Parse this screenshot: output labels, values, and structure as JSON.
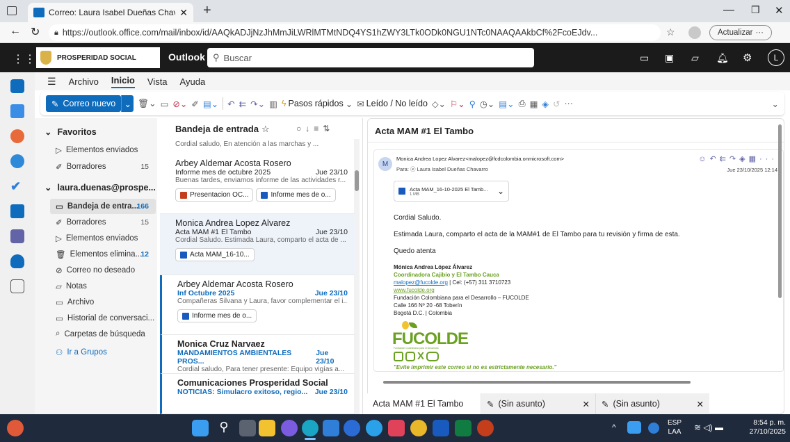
{
  "browser": {
    "tab_title": "Correo: Laura Isabel Dueñas Chav",
    "url": "https://outlook.office.com/mail/inbox/id/AAQkADJjNzJhMmJiLWRlMTMtNDQ4YS1hZWY3LTk0ODk0NGU1NTc0NAAQAAkbCf%2FcoEJdv...",
    "update_label": "Actualizar"
  },
  "header": {
    "brand": "PROSPERIDAD SOCIAL",
    "app": "Outlook",
    "search_placeholder": "Buscar",
    "avatar": "L"
  },
  "ribbon_tabs": [
    "Archivo",
    "Inicio",
    "Vista",
    "Ayuda"
  ],
  "ribbon": {
    "new_mail": "Correo nuevo",
    "quick_steps": "Pasos rápidos",
    "read_unread": "Leído / No leído"
  },
  "folders": {
    "favorites_label": "Favoritos",
    "favorites": [
      {
        "label": "Elementos enviados",
        "count": ""
      },
      {
        "label": "Borradores",
        "count": "15"
      }
    ],
    "account_label": "laura.duenas@prospe...",
    "account_items": [
      {
        "label": "Bandeja de entra...",
        "count": "166"
      },
      {
        "label": "Borradores",
        "count": "15"
      },
      {
        "label": "Elementos enviados",
        "count": ""
      },
      {
        "label": "Elementos elimina...",
        "count": "12"
      },
      {
        "label": "Correo no deseado",
        "count": ""
      },
      {
        "label": "Notas",
        "count": ""
      },
      {
        "label": "Archivo",
        "count": ""
      },
      {
        "label": "Historial de conversaci...",
        "count": ""
      },
      {
        "label": "Carpetas de búsqueda",
        "count": ""
      }
    ],
    "groups_link": "Ir a Grupos"
  },
  "list": {
    "title": "Bandeja de entrada",
    "top_preview": "Cordial saludo, En atención a las marchas y ...",
    "messages": [
      {
        "from": "Arbey Aldemar Acosta Rosero",
        "subject": "Informe mes de octubre 2025",
        "date": "Jue 23/10",
        "preview": "Buenas tardes, enviamos informe de las actividades r...",
        "attachments": [
          "Presentacion OC...",
          "Informe mes de o..."
        ]
      },
      {
        "from": "Monica Andrea Lopez Alvarez",
        "subject": "Acta MAM #1 El Tambo",
        "date": "Jue 23/10",
        "preview": "Cordial Saludo. Estimada Laura, comparto el acta de ...",
        "attachments": [
          "Acta MAM_16-10..."
        ]
      },
      {
        "from": "Arbey Aldemar Acosta Rosero",
        "subject": "Inf Octubre 2025",
        "date": "Jue 23/10",
        "preview": "Compañeras Silvana y Laura, favor complementar el i...",
        "attachments": [
          "Informe mes de o..."
        ]
      },
      {
        "from": "Monica Cruz Narvaez",
        "subject": "MANDAMIENTOS AMBIENTALES PROS...",
        "date": "Jue 23/10",
        "preview": "Cordial saludo, Para tener presente: Equipo vigías a...",
        "attachments": []
      },
      {
        "from": "Comunicaciones Prosperidad Social",
        "subject": "NOTICIAS: Simulacro exitoso, regio...",
        "date": "Jue 23/10",
        "preview": "",
        "attachments": []
      }
    ]
  },
  "reading": {
    "subject": "Acta MAM #1 El Tambo",
    "sender_initial": "M",
    "sender": "Monica Andrea Lopez Alvarez<malopez@fcdcolombia.onmicrosoft.com>",
    "to": "Para: ⓔ Laura Isabel Dueñas Chavarro",
    "date": "Jue 23/10/2025 12:14",
    "attachment_name": "Acta MAM_16-10-2025 El Tamb...",
    "attachment_size": "1 MB",
    "greeting": "Cordial Saludo.",
    "body": "Estimada Laura, comparto el acta de la MAM#1 de El Tambo para tu revisión y firma de esta.",
    "closing": "Quedo atenta",
    "sig_name": "Mónica Andrea López Álvarez",
    "sig_role": "Coordinadora Cajibío y El Tambo Cauca",
    "sig_email": "malopez@fucolde.org",
    "sig_phone": " | Cel: (+57) 311 3710723",
    "sig_web": "www.fucolde.org",
    "sig_org": "Fundación Colombiana para el Desarrollo – FUCOLDE",
    "sig_addr": "Calle 166 Nº 20 -68 Toberín",
    "sig_city": "Bogotá D.C. | Colombia",
    "logo_text": "FUCOLDE",
    "logo_sub": "Fundación Colombiana para el Desarrollo",
    "footer_note": "\"Evite imprimir este correo si no es estrictamente necesario.\""
  },
  "compose_tabs": [
    {
      "label": "Acta MAM #1 El Tambo"
    },
    {
      "label": "(Sin asunto)"
    },
    {
      "label": "(Sin asunto)"
    }
  ],
  "taskbar": {
    "lang1": "ESP",
    "lang2": "LAA",
    "time": "8:54 p. m.",
    "date": "27/10/2025"
  },
  "colors": {
    "accent": "#0f6cbd",
    "header": "#1b1b1b",
    "green": "#6aa121"
  }
}
